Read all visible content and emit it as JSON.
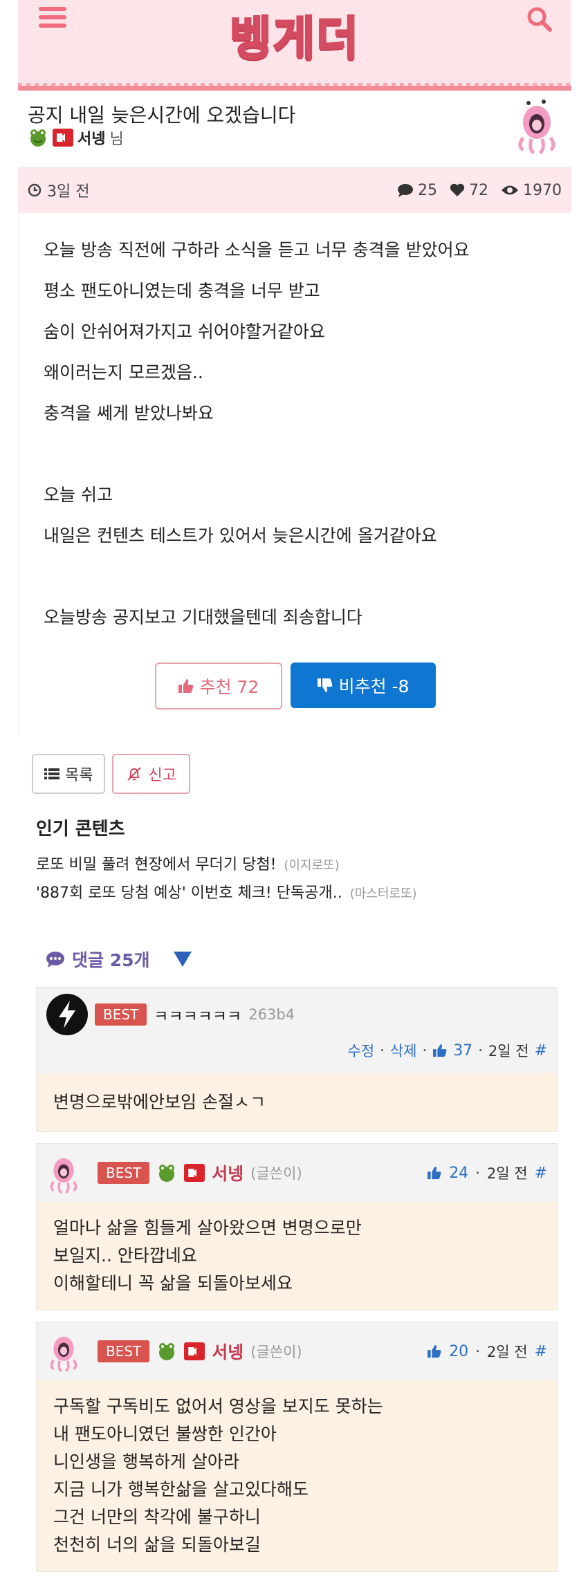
{
  "header": {
    "logo": "벵게더"
  },
  "post": {
    "title": "공지 내일 늦은시간에 오겠습니다",
    "author": "서넹",
    "author_suffix": "님",
    "time": "3일 전",
    "comments": "25",
    "likes": "72",
    "views": "1970",
    "body_lines": [
      "오늘 방송 직전에 구하라 소식을 듣고 너무 충격을 받았어요",
      "평소 팬도아니였는데 충격을 너무 받고",
      "숨이 안쉬어져가지고 쉬어야할거같아요",
      "왜이러는지 모르겠음..",
      "충격을 쎄게 받았나봐요",
      "",
      "오늘 쉬고",
      "내일은 컨텐츠 테스트가 있어서 늦은시간에 올거같아요",
      "",
      "오늘방송 공지보고 기대했을텐데 죄송합니다"
    ],
    "upvote_label": "추천 72",
    "downvote_label": "비추천 -8"
  },
  "actions": {
    "list_label": "목록",
    "report_label": "신고"
  },
  "popular": {
    "title": "인기 콘텐츠",
    "items": [
      {
        "text": "로또 비밀 풀려 현장에서 무더기 당첨!",
        "source": "(이지로또)"
      },
      {
        "text": "'887회 로또 당첨 예상' 이번호 체크! 단독공개..",
        "source": "(마스터로또)"
      }
    ]
  },
  "comments_header": "댓글 25개",
  "comments": [
    {
      "badge": "BEST",
      "name": "ㅋㅋㅋㅋㅋㅋ",
      "id": "263b4",
      "edit": "수정",
      "delete": "삭제",
      "likes": "37",
      "time": "2일 전",
      "hash": "#",
      "body": [
        "변명으로밖에안보임 손절ㅅㄱ"
      ]
    },
    {
      "badge": "BEST",
      "name": "서넹",
      "role": "(글쓴이)",
      "likes": "24",
      "time": "2일 전",
      "hash": "#",
      "body": [
        "얼마나 삶을 힘들게 살아왔으면 변명으로만",
        "보일지.. 안타깝네요",
        "이해할테니 꼭 삶을 되돌아보세요"
      ]
    },
    {
      "badge": "BEST",
      "name": "서넹",
      "role": "(글쓴이)",
      "likes": "20",
      "time": "2일 전",
      "hash": "#",
      "body": [
        "구독할 구독비도 없어서 영상을 보지도 못하는",
        "내 팬도아니였던 불쌍한 인간아",
        "니인생을 행복하게 살아라",
        "지금 니가 행복한삶을 살고있다해도",
        "그건 너만의 착각에 불구하니",
        "천천히 너의 삶을 되돌아보길"
      ]
    }
  ],
  "colors": {
    "accent": "#f06b7d",
    "blue": "#0f76d1",
    "best": "#d9534f"
  }
}
